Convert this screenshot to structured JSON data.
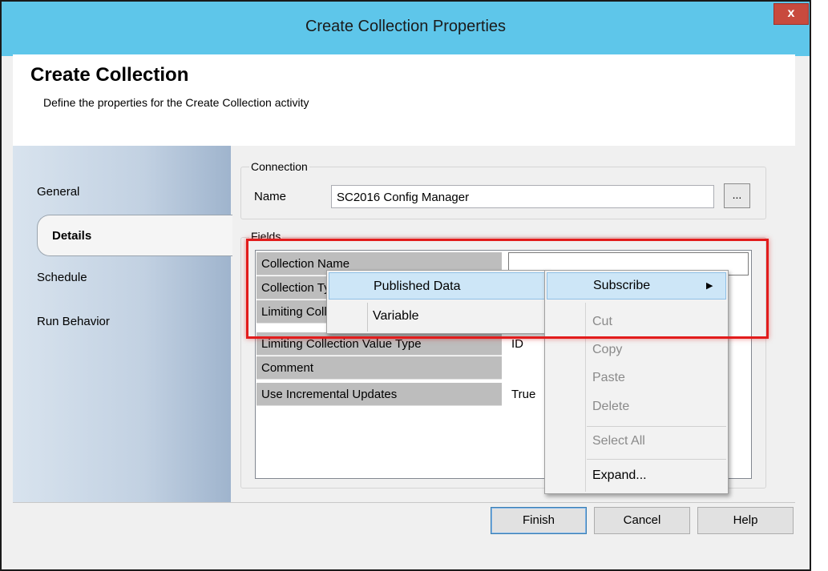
{
  "window": {
    "title": "Create Collection Properties",
    "close_glyph": "x"
  },
  "header": {
    "title": "Create Collection",
    "subtitle": "Define the properties for the Create Collection activity"
  },
  "nav": {
    "items": [
      {
        "label": "General",
        "selected": false
      },
      {
        "label": "Details",
        "selected": true
      },
      {
        "label": "Schedule",
        "selected": false
      },
      {
        "label": "Run Behavior",
        "selected": false
      }
    ]
  },
  "connection": {
    "legend": "Connection",
    "name_label": "Name",
    "name_value": "SC2016 Config Manager",
    "browse_label": "..."
  },
  "fields": {
    "legend": "Fields",
    "rows": [
      {
        "label": "Collection Name",
        "value": ""
      },
      {
        "label": "Collection Type",
        "value": ""
      },
      {
        "label": "Limiting Collection",
        "value": ""
      },
      {
        "label": "Limiting Collection Value Type",
        "value": "ID"
      },
      {
        "label": "Comment",
        "value": ""
      },
      {
        "label": "Use Incremental Updates",
        "value": "True"
      }
    ]
  },
  "submenu": {
    "items": [
      "Published Data",
      "Variable"
    ],
    "highlighted": "Published Data"
  },
  "context_menu": {
    "items": [
      {
        "label": "Subscribe",
        "enabled": true,
        "has_submenu": true
      },
      {
        "label": "Cut",
        "enabled": false
      },
      {
        "label": "Copy",
        "enabled": false
      },
      {
        "label": "Paste",
        "enabled": false
      },
      {
        "label": "Delete",
        "enabled": false
      },
      {
        "label": "Select All",
        "enabled": false
      },
      {
        "label": "Expand...",
        "enabled": true
      }
    ],
    "arrow_glyph": "▶"
  },
  "footer": {
    "finish_label": "Finish",
    "cancel_label": "Cancel",
    "help_label": "Help"
  },
  "colors": {
    "titlebar": "#5ec6ea",
    "close": "#c84a3e",
    "highlight_box": "#e21c1c",
    "menu_highlight": "#cde6f7"
  }
}
